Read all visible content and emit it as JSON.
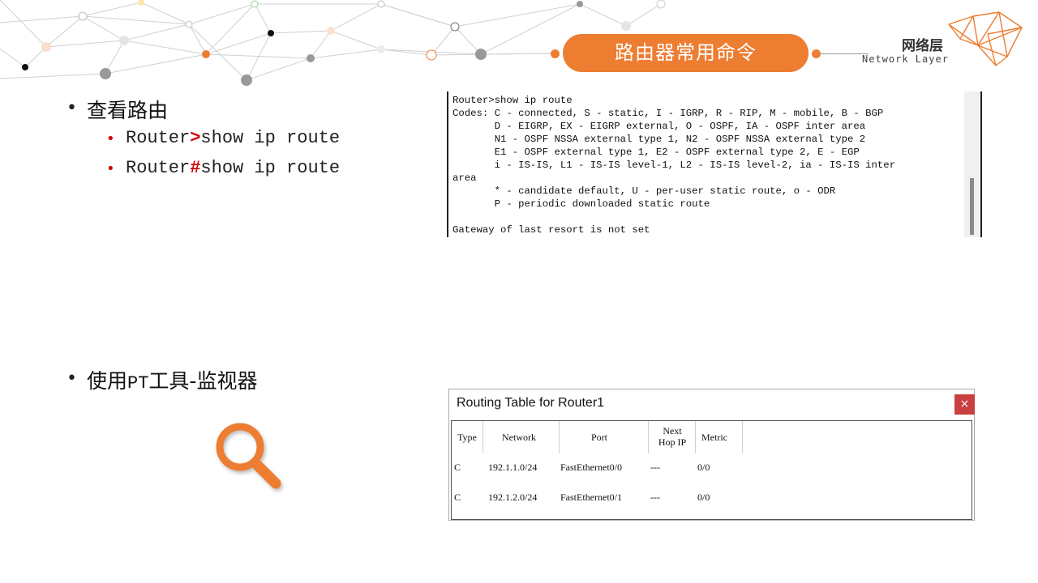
{
  "header": {
    "title": "路由器常用命令",
    "section_zh": "网络层",
    "section_en": "Network Layer",
    "accent_color": "#ed7d31"
  },
  "bullets": [
    {
      "text": "查看路由",
      "commands": [
        {
          "prefix": "Router",
          "prompt": ">",
          "command": "show ip route"
        },
        {
          "prefix": "Router",
          "prompt": "#",
          "command": "show ip route"
        }
      ]
    },
    {
      "text_part1": "使用",
      "text_mono": "PT",
      "text_part2": "工具-监视器"
    }
  ],
  "terminal": {
    "lines": [
      "Router>show ip route",
      "Codes: C - connected, S - static, I - IGRP, R - RIP, M - mobile, B - BGP",
      "       D - EIGRP, EX - EIGRP external, O - OSPF, IA - OSPF inter area",
      "       N1 - OSPF NSSA external type 1, N2 - OSPF NSSA external type 2",
      "       E1 - OSPF external type 1, E2 - OSPF external type 2, E - EGP",
      "       i - IS-IS, L1 - IS-IS level-1, L2 - IS-IS level-2, ia - IS-IS inter",
      "area",
      "       * - candidate default, U - per-user static route, o - ODR",
      "       P - periodic downloaded static route",
      "",
      "Gateway of last resort is not set"
    ]
  },
  "routing_table": {
    "title": "Routing Table for Router1",
    "close_label": "×",
    "columns": [
      "Type",
      "Network",
      "Port",
      "Next Hop IP",
      "Metric"
    ],
    "rows": [
      {
        "type": "C",
        "network": "192.1.1.0/24",
        "port": "FastEthernet0/0",
        "next_hop": "---",
        "metric": "0/0"
      },
      {
        "type": "C",
        "network": "192.1.2.0/24",
        "port": "FastEthernet0/1",
        "next_hop": "---",
        "metric": "0/0"
      }
    ]
  },
  "icons": {
    "magnifier": "magnifier-icon",
    "logo": "polygon-logo-icon",
    "decoration": "network-nodes-decoration"
  }
}
